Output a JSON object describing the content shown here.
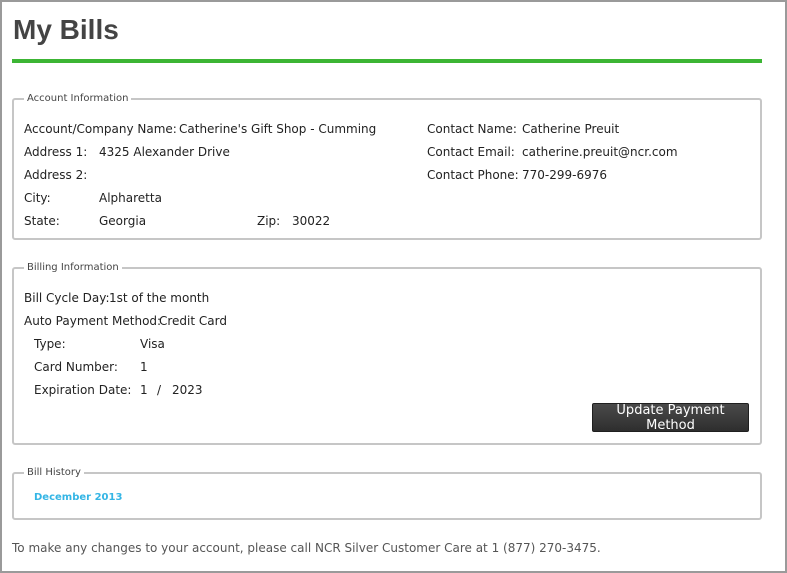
{
  "page": {
    "title": "My Bills",
    "accent": "#3cb534"
  },
  "account": {
    "legend": "Account Information",
    "company_label": "Account/Company Name:",
    "company_value": "Catherine's Gift Shop - Cumming",
    "address1_label": "Address 1:",
    "address1_value": "4325 Alexander Drive",
    "address2_label": "Address 2:",
    "address2_value": "",
    "city_label": "City:",
    "city_value": "Alpharetta",
    "state_label": "State:",
    "state_value": "Georgia",
    "zip_label": "Zip:",
    "zip_value": "30022",
    "contact_name_label": "Contact Name:",
    "contact_name_value": "Catherine Preuit",
    "contact_email_label": "Contact Email:",
    "contact_email_value": "catherine.preuit@ncr.com",
    "contact_phone_label": "Contact Phone:",
    "contact_phone_value": "770-299-6976"
  },
  "billing": {
    "legend": "Billing Information",
    "cycle_label": "Bill Cycle Day:",
    "cycle_value": "1st of the month",
    "auto_label": "Auto Payment Method:",
    "auto_value": "Credit Card",
    "type_label": "Type:",
    "type_value": "Visa",
    "card_label": "Card Number:",
    "card_value": "1",
    "exp_label": "Expiration Date:",
    "exp_month": "1",
    "exp_sep": "/",
    "exp_year": "2023",
    "update_button": "Update Payment Method"
  },
  "history": {
    "legend": "Bill History",
    "items": [
      "December 2013"
    ],
    "link_color": "#33b5e5"
  },
  "footer": {
    "text": "To make any changes to your account, please call NCR Silver Customer Care at 1 (877) 270-3475."
  }
}
